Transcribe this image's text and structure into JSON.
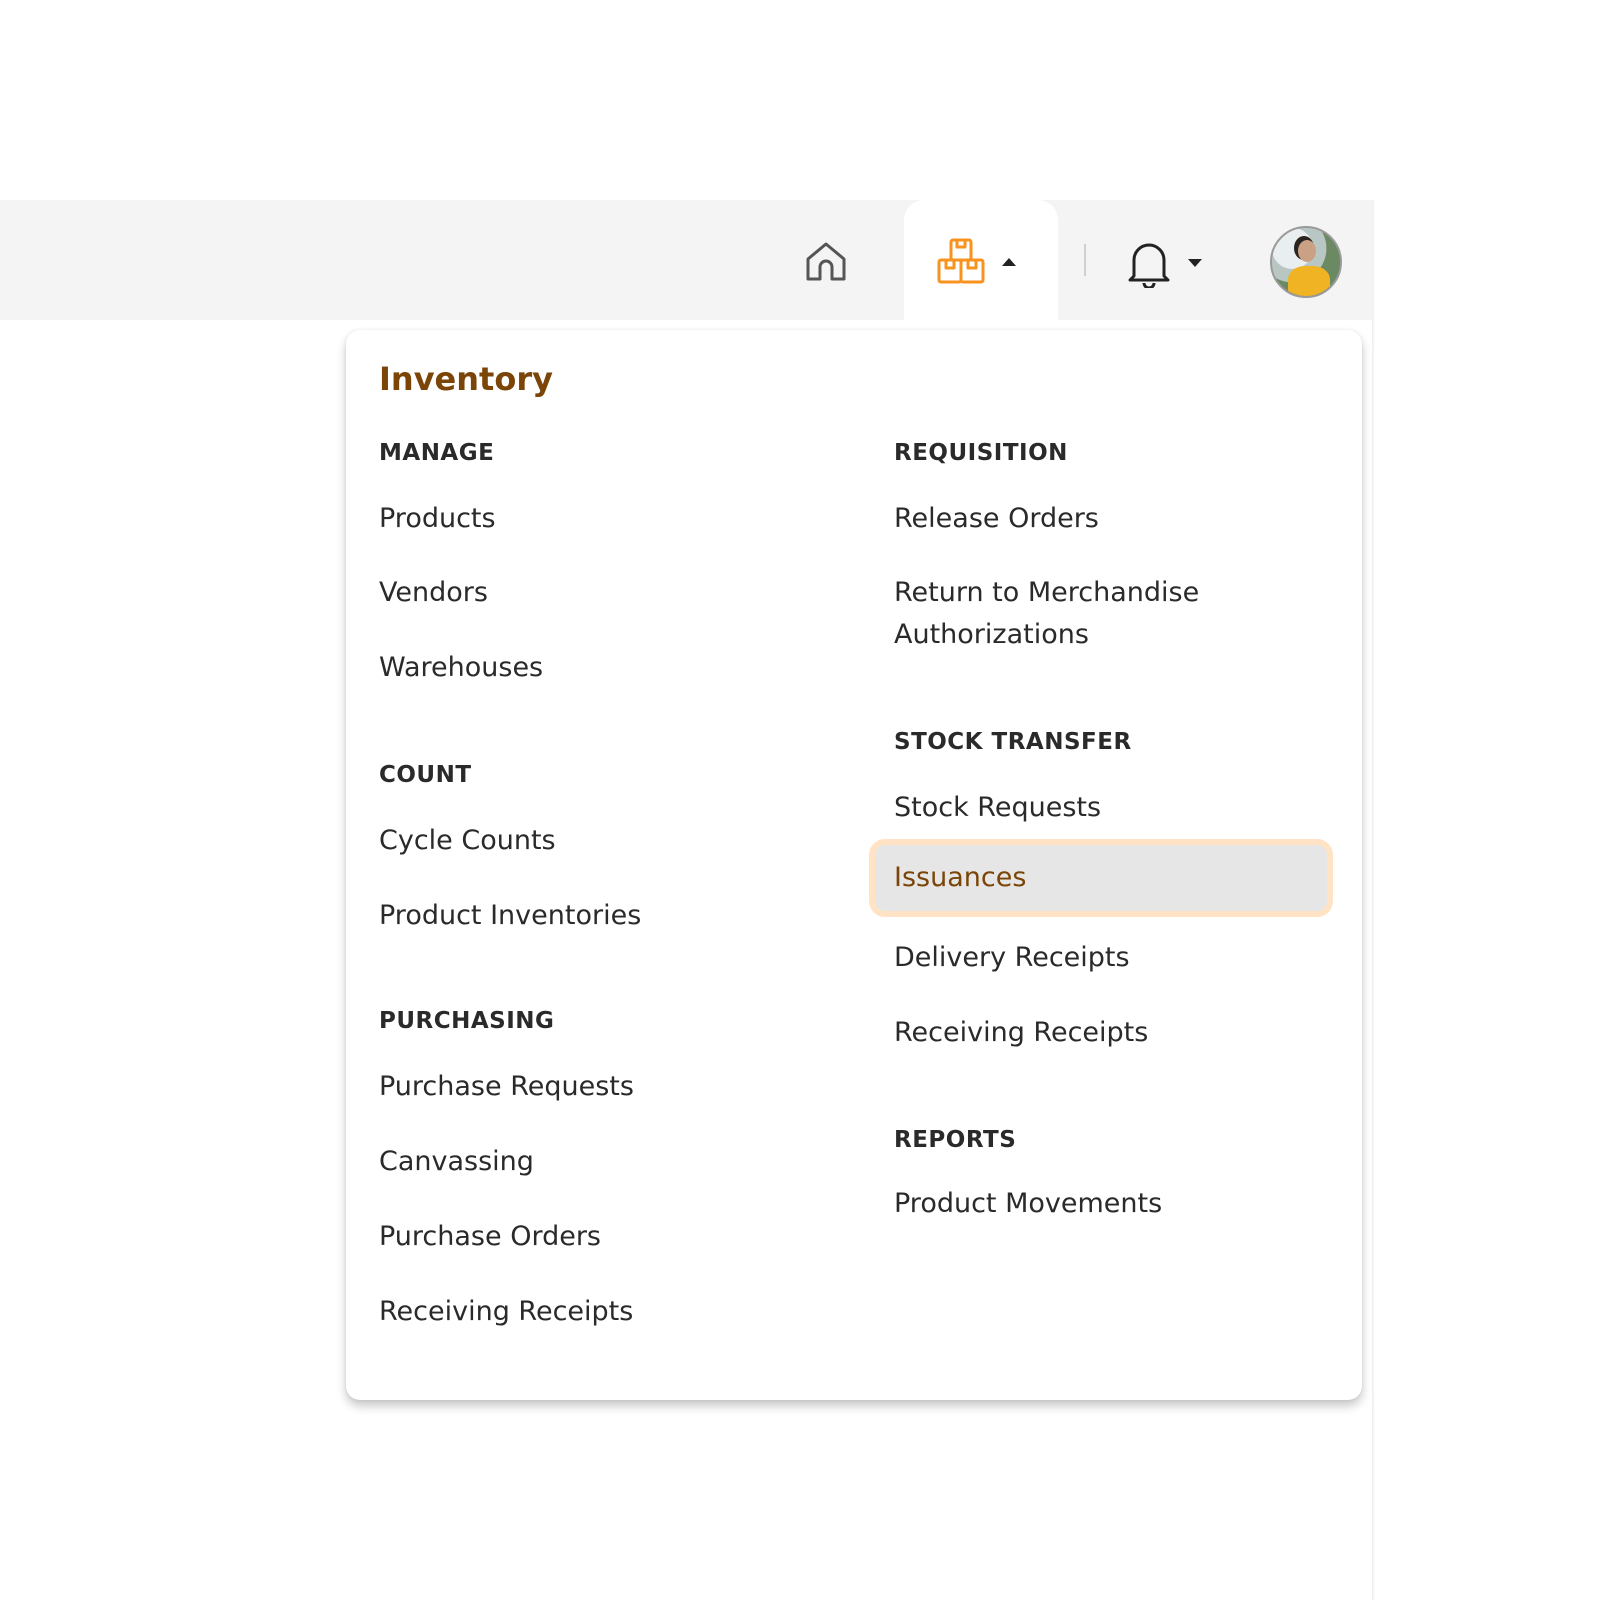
{
  "header": {
    "home_icon": "home-icon",
    "inventory_icon": "boxes-icon",
    "inventory_caret": "caret-up-icon",
    "notifications_icon": "bell-icon",
    "notifications_caret": "caret-down-icon",
    "avatar": "user-avatar",
    "accent_color": "#f7931e"
  },
  "menu": {
    "title": "Inventory",
    "title_color": "#7a4506",
    "left_sections": [
      {
        "heading": "MANAGE",
        "items": [
          "Products",
          "Vendors",
          "Warehouses"
        ]
      },
      {
        "heading": "COUNT",
        "items": [
          "Cycle Counts",
          "Product Inventories"
        ]
      },
      {
        "heading": "PURCHASING",
        "items": [
          "Purchase Requests",
          "Canvassing",
          "Purchase Orders",
          "Receiving Receipts"
        ]
      }
    ],
    "right_sections": [
      {
        "heading": "REQUISITION",
        "items": [
          "Release Orders",
          "Return to Merchandise Authorizations"
        ]
      },
      {
        "heading": "STOCK TRANSFER",
        "items": [
          "Stock Requests",
          "Issuances",
          "Delivery Receipts",
          "Receiving Receipts"
        ]
      },
      {
        "heading": "REPORTS",
        "items": [
          "Product Movements"
        ]
      }
    ],
    "selected_item": "Issuances"
  }
}
